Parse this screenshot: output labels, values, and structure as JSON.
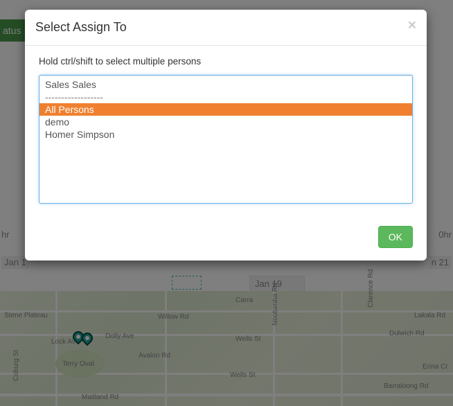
{
  "modal": {
    "title": "Select Assign To",
    "close_label": "×",
    "hint": "Hold ctrl/shift to select multiple persons",
    "options": [
      {
        "label": "Sales Sales",
        "selected": false,
        "disabled": false
      },
      {
        "label": "------------------",
        "selected": false,
        "disabled": true
      },
      {
        "label": "All Persons",
        "selected": true,
        "disabled": false
      },
      {
        "label": "demo",
        "selected": false,
        "disabled": false
      },
      {
        "label": "Homer Simpson",
        "selected": false,
        "disabled": false
      }
    ],
    "ok_label": "OK"
  },
  "background": {
    "status_btn": "atus",
    "hr_left": "hr",
    "hr_right": "0hr",
    "date_left": "Jan 1",
    "date_center": "Jan 19",
    "date_right": "n 21",
    "map_labels": {
      "terry_oval": "Terry Oval",
      "willow": "Willow Rd",
      "dolly": "Dolly Ave",
      "avalon": "Avalon Rd",
      "wells": "Wells St",
      "lakala": "Lakala Rd",
      "dulwich": "Dulwich Rd",
      "barraloong": "Barraloong Rd",
      "maitland": "Maitland Rd",
      "lock": "Lock Ave",
      "clarence": "Clarence Rd",
      "nootumba": "Nootumba Rd",
      "carra": "Carra",
      "coburg": "Coburg St",
      "plateau": "Stene Plateau",
      "erina": "Erina Cr"
    }
  }
}
